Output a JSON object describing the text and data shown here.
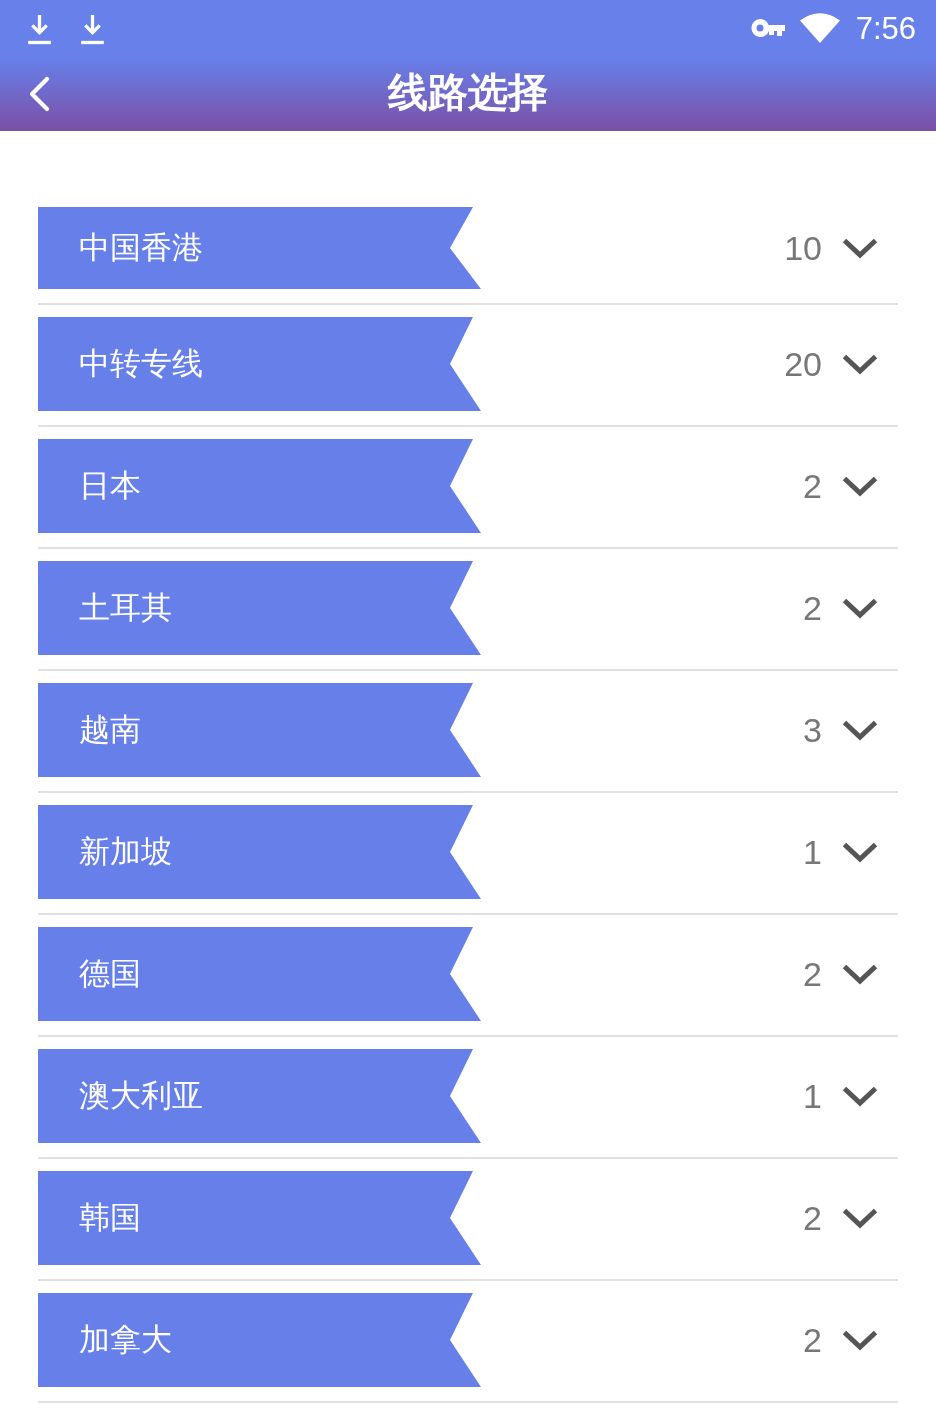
{
  "status_bar": {
    "time": "7:56"
  },
  "header": {
    "title": "线路选择"
  },
  "groups": [
    {
      "name": "中国香港",
      "count": "10",
      "expanded": false
    },
    {
      "name": "中转专线",
      "count": "20",
      "expanded": false
    },
    {
      "name": "日本",
      "count": "2",
      "expanded": false
    },
    {
      "name": "土耳其",
      "count": "2",
      "expanded": false
    },
    {
      "name": "越南",
      "count": "3",
      "expanded": false
    },
    {
      "name": "新加坡",
      "count": "1",
      "expanded": false
    },
    {
      "name": "德国",
      "count": "2",
      "expanded": false
    },
    {
      "name": "澳大利亚",
      "count": "1",
      "expanded": false
    },
    {
      "name": "韩国",
      "count": "2",
      "expanded": false
    },
    {
      "name": "加拿大",
      "count": "2",
      "expanded": false
    }
  ]
}
